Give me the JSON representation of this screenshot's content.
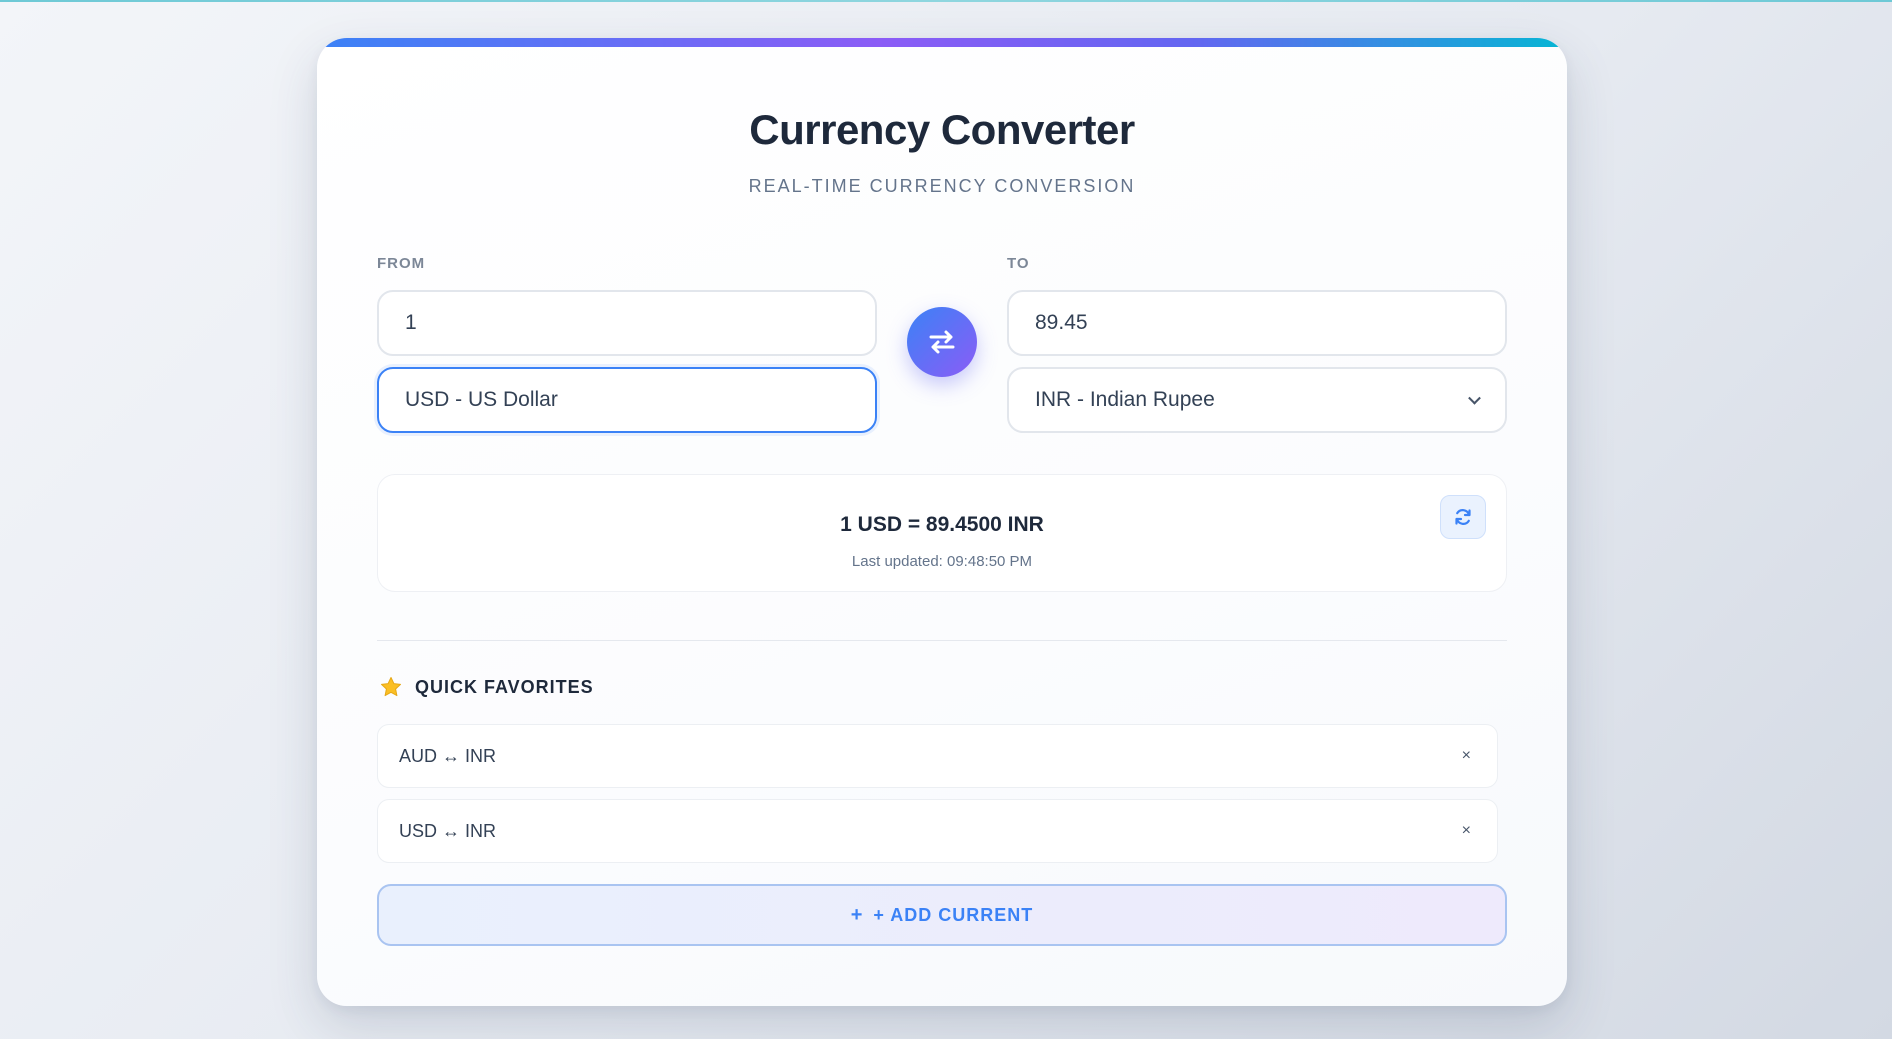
{
  "app": {
    "title": "Currency Converter",
    "subtitle": "REAL-TIME CURRENCY CONVERSION"
  },
  "from": {
    "label": "FROM",
    "amount": "1",
    "currency": "USD - US Dollar"
  },
  "to": {
    "label": "TO",
    "amount": "89.45",
    "currency": "INR - Indian Rupee"
  },
  "rate": {
    "text": "1 USD = 89.4500 INR",
    "updated": "Last updated: 09:48:50 PM"
  },
  "favorites": {
    "title": "QUICK FAVORITES",
    "items": [
      {
        "label": "AUD ↔ INR",
        "remove": "×"
      },
      {
        "label": "USD ↔ INR",
        "remove": "×"
      }
    ],
    "add_icon": "+",
    "add_label": "+ ADD CURRENT"
  },
  "icons": {
    "swap": "swap-arrows-icon",
    "refresh": "refresh-icon",
    "star": "star-icon"
  },
  "colors": {
    "accent_blue": "#3b82f6",
    "accent_purple": "#8b5cf6",
    "star": "#fbbf24"
  }
}
